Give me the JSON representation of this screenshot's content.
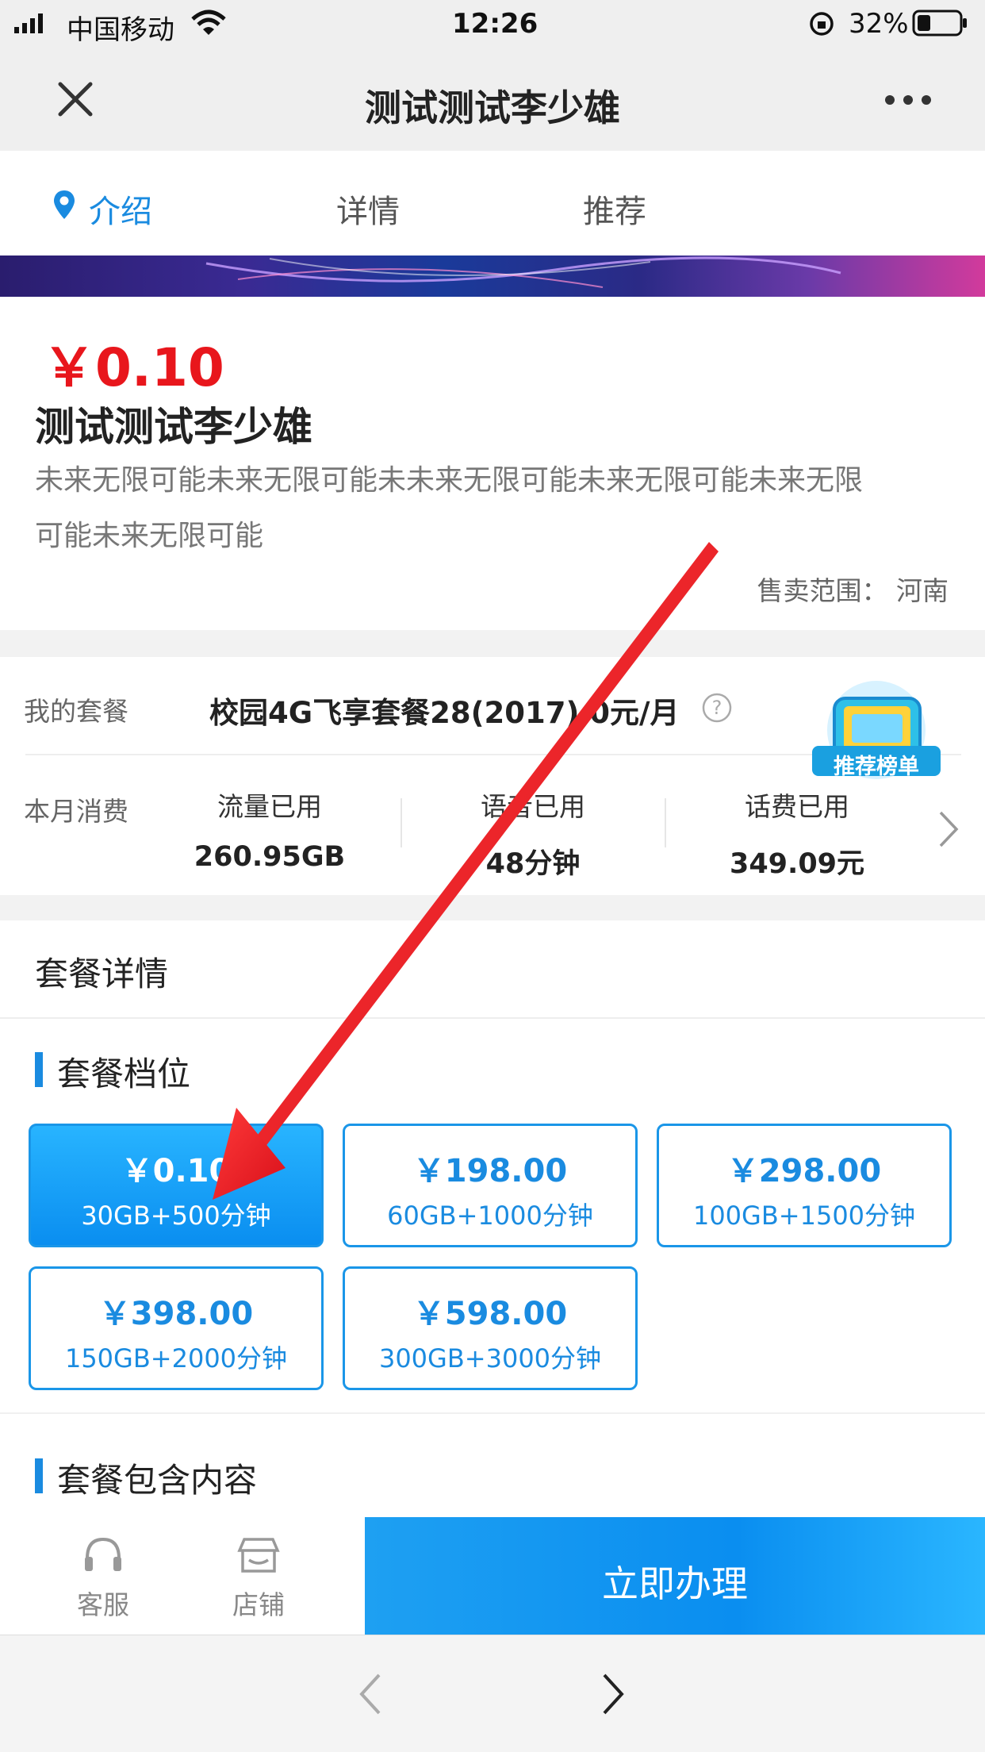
{
  "status": {
    "carrier": "中国移动",
    "time": "12:26",
    "battery": "32%"
  },
  "nav": {
    "title": "测试测试李少雄"
  },
  "tabs": [
    {
      "label": "介绍"
    },
    {
      "label": "详情"
    },
    {
      "label": "推荐"
    }
  ],
  "product": {
    "price": "￥0.10",
    "name": "测试测试李少雄",
    "desc_line1": "未来无限可能未来无限可能未未来无限可能未来无限可能未来无限",
    "desc_line2": "可能未来无限可能",
    "sale_range": "售卖范围：  河南"
  },
  "my_plan": {
    "label": "我的套餐",
    "value": "校园4G飞享套餐28(2017) 0元/月",
    "badge": "推荐榜单",
    "month_label": "本月消费",
    "stats": [
      {
        "label": "流量已用",
        "value": "260.95GB"
      },
      {
        "label": "语音已用",
        "value": "48分钟"
      },
      {
        "label": "话费已用",
        "value": "349.09元"
      }
    ]
  },
  "details": {
    "header": "套餐详情",
    "tier_title": "套餐档位",
    "tiers": [
      {
        "price": "￥0.10",
        "desc": "30GB+500分钟",
        "selected": true
      },
      {
        "price": "￥198.00",
        "desc": "60GB+1000分钟",
        "selected": false
      },
      {
        "price": "￥298.00",
        "desc": "100GB+1500分钟",
        "selected": false
      },
      {
        "price": "￥398.00",
        "desc": "150GB+2000分钟",
        "selected": false
      },
      {
        "price": "￥598.00",
        "desc": "300GB+3000分钟",
        "selected": false
      }
    ],
    "contents_title": "套餐包含内容"
  },
  "bottom_bar": {
    "service": "客服",
    "shop": "店铺",
    "action": "立即办理"
  },
  "colors": {
    "accent": "#1a8be0",
    "price_red": "#e8161c",
    "annotation_arrow": "#e8202a"
  },
  "icons": [
    "close-icon",
    "more-icon",
    "location-pin-icon",
    "help-icon",
    "chevron-right-icon",
    "headset-icon",
    "store-icon",
    "back-icon",
    "forward-icon"
  ]
}
